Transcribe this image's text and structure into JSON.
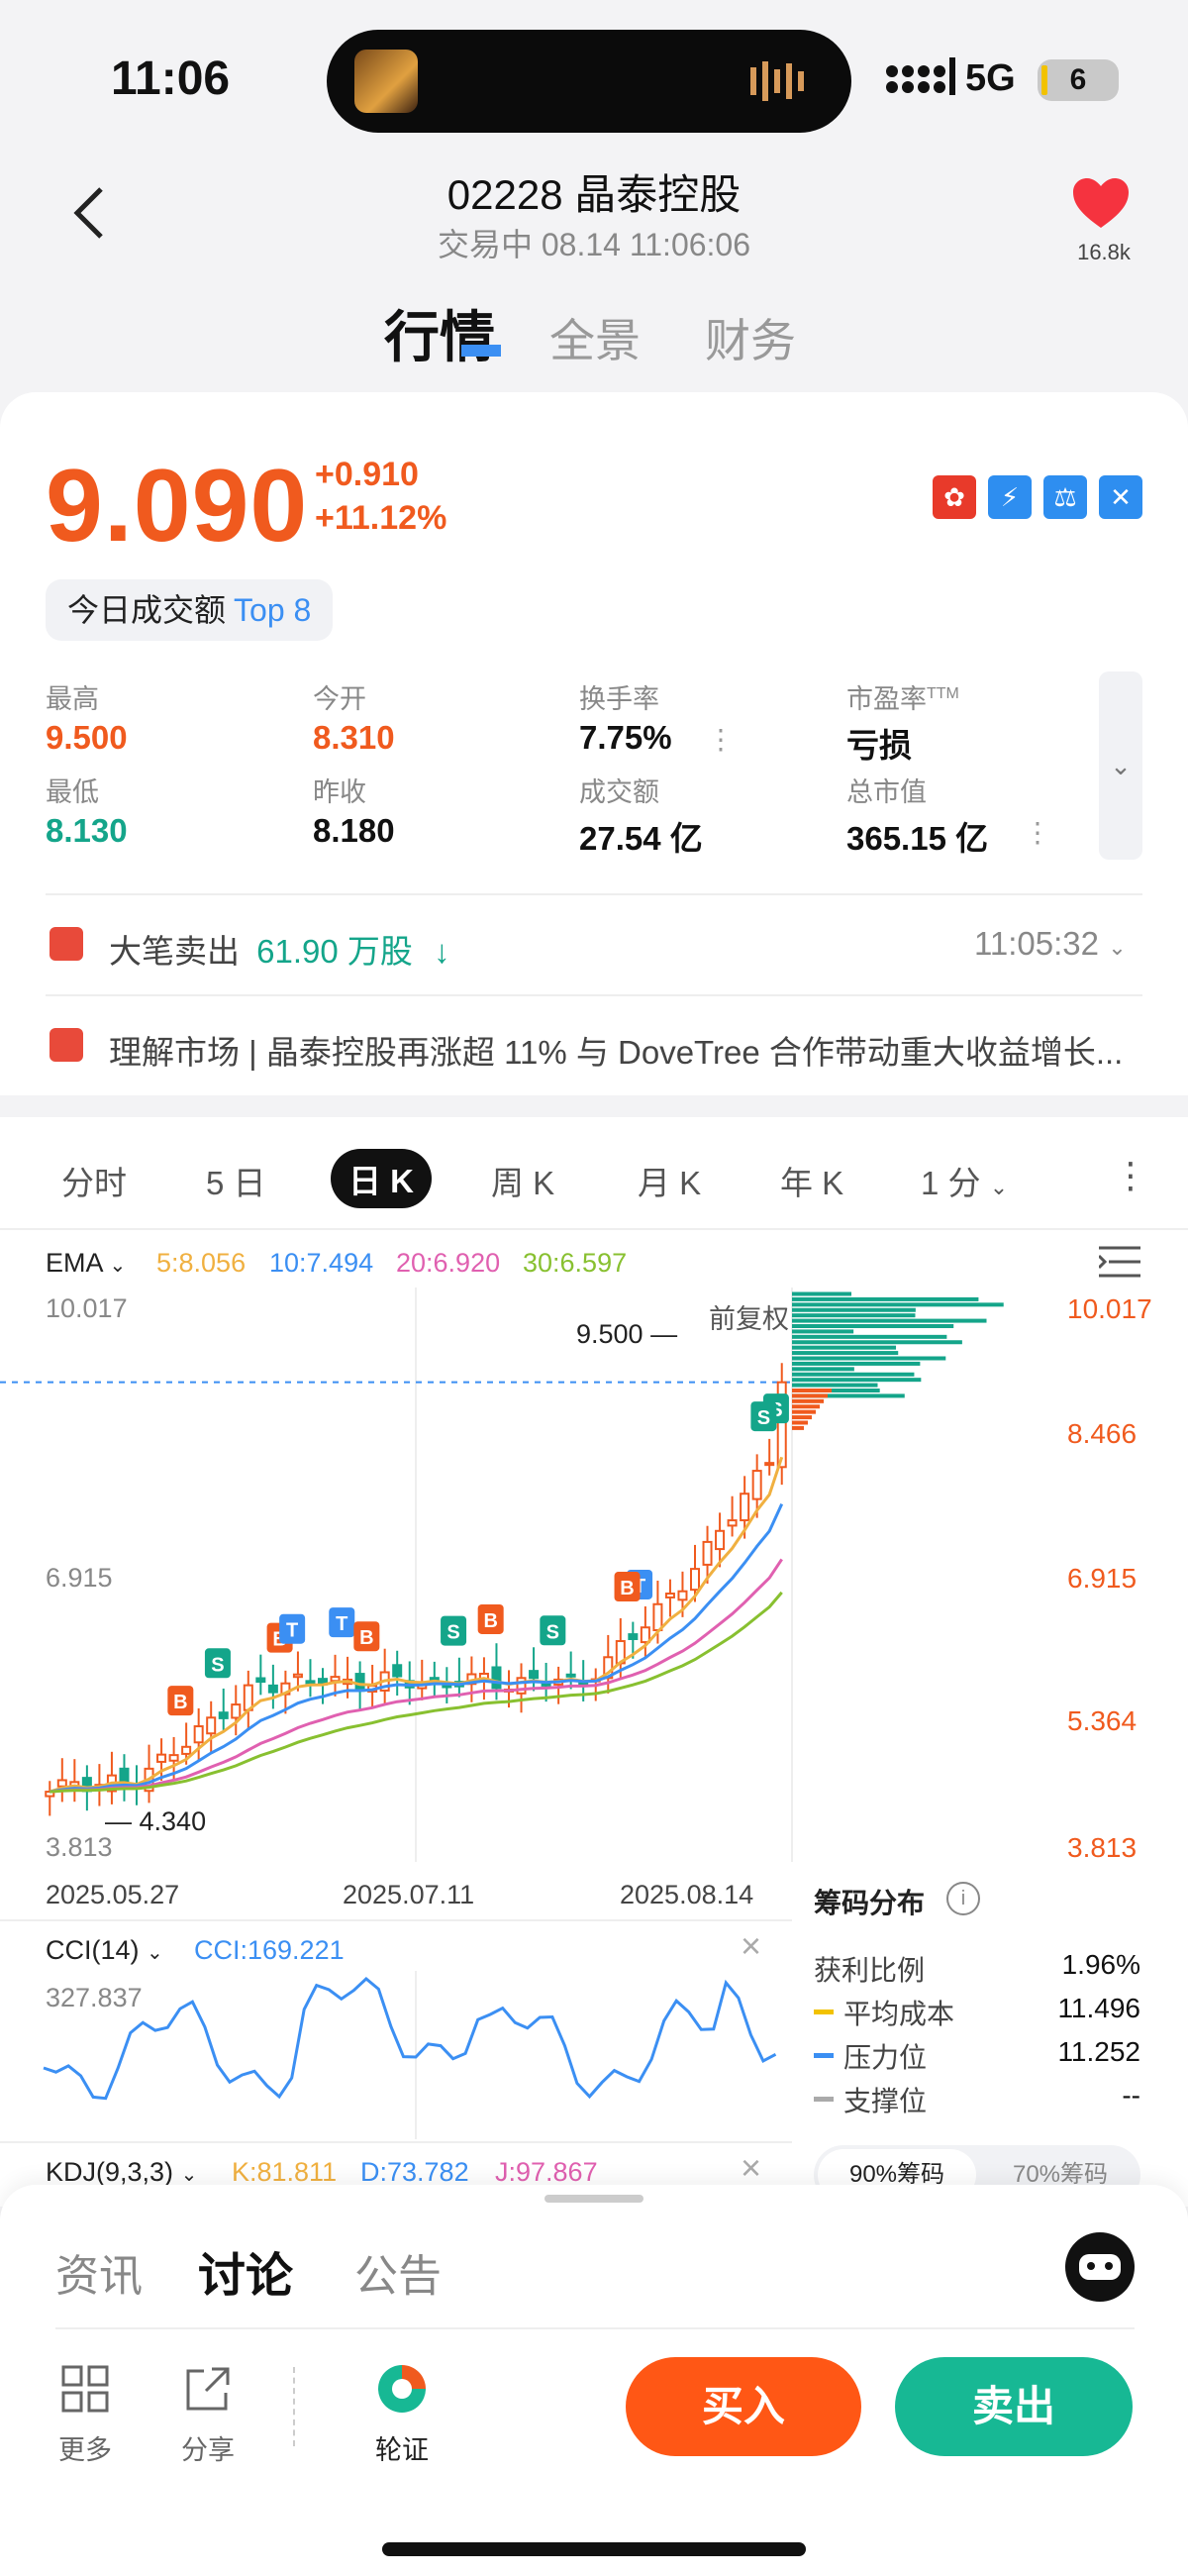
{
  "status": {
    "time": "11:06",
    "network": "5G",
    "battery": "6"
  },
  "header": {
    "title": "02228 晶泰控股",
    "subtitle": "交易中 08.14 11:06:06",
    "likes": "16.8k"
  },
  "main_tabs": [
    "行情",
    "全景",
    "财务"
  ],
  "quote": {
    "price": "9.090",
    "change": "+0.910",
    "change_pct": "+11.12%",
    "badge_label": "今日成交额",
    "badge_rank": "Top 8",
    "stats": [
      {
        "label": "最高",
        "value": "9.500"
      },
      {
        "label": "今开",
        "value": "8.310"
      },
      {
        "label": "换手率",
        "value": "7.75%"
      },
      {
        "label": "市盈率",
        "label_sup": "TTM",
        "value": "亏损"
      },
      {
        "label": "最低",
        "value": "8.130"
      },
      {
        "label": "昨收",
        "value": "8.180"
      },
      {
        "label": "成交额",
        "value": "27.54 亿"
      },
      {
        "label": "总市值",
        "value": "365.15 亿"
      }
    ]
  },
  "block_trade": {
    "text": "大笔卖出",
    "amount": "61.90 万股",
    "time": "11:05:32"
  },
  "news": {
    "text": "理解市场 | 晶泰控股再涨超 11% 与 DoveTree 合作带动重大收益增长..."
  },
  "kline_tabs": [
    "分时",
    "5 日",
    "日 K",
    "周 K",
    "月 K",
    "年 K",
    "1 分"
  ],
  "ema": {
    "label": "EMA",
    "e5": "5:8.056",
    "e10": "10:7.494",
    "e20": "20:6.920",
    "e30": "30:6.597"
  },
  "chart_data": {
    "type": "candlestick",
    "title": "日 K",
    "x_ticks": [
      "2025.05.27",
      "2025.07.11",
      "2025.08.14"
    ],
    "y_left_ticks": [
      "10.017",
      "6.915",
      "3.813"
    ],
    "y_right_ticks": [
      "10.017",
      "8.466",
      "6.915",
      "5.364",
      "3.813"
    ],
    "ylim": [
      3.813,
      10.017
    ],
    "high_label": "9.500",
    "low_label": "4.340",
    "adjust_label": "前复权",
    "current_price_line": 9.09,
    "ema_colors": {
      "e5": "#f0b040",
      "e10": "#3b8ff3",
      "e20": "#e060b0",
      "e30": "#88c030"
    },
    "cci": {
      "label": "CCI(14)",
      "value_text": "CCI:169.221",
      "top_tick": "327.837"
    },
    "kdj": {
      "label": "KDJ(9,3,3)",
      "k": "K:81.811",
      "d": "D:73.782",
      "j": "J:97.867"
    }
  },
  "chip": {
    "title": "筹码分布",
    "rows": [
      {
        "label": "获利比例",
        "value": "1.96%"
      },
      {
        "label": "平均成本",
        "value": "11.496",
        "color": "#f2c200"
      },
      {
        "label": "压力位",
        "value": "11.252",
        "color": "#3b8ff3"
      },
      {
        "label": "支撑位",
        "value": "--",
        "color": "#aaaaaa"
      }
    ],
    "tab_90": "90%筹码",
    "tab_70": "70%筹码"
  },
  "bottom_tabs": [
    "资讯",
    "讨论",
    "公告"
  ],
  "tools": {
    "more": "更多",
    "share": "分享",
    "warrant": "轮证"
  },
  "buy_label": "买入",
  "sell_label": "卖出",
  "colors": {
    "up": "#f05a1e",
    "down": "#14a58a",
    "accent": "#3b8ff3"
  }
}
